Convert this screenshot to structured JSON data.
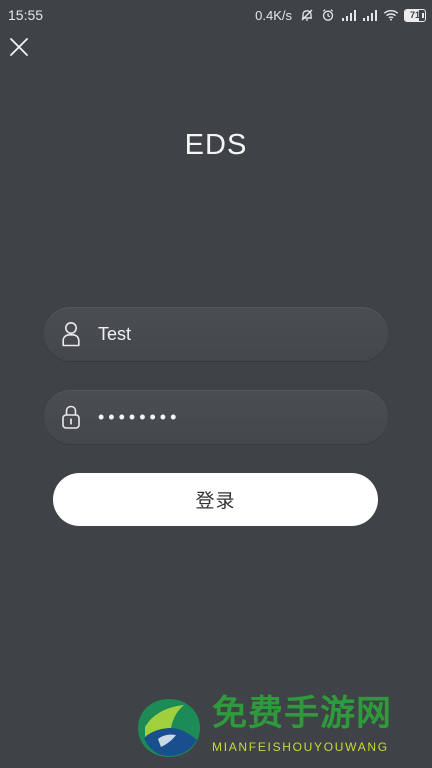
{
  "status_bar": {
    "time": "15:55",
    "network_speed": "0.4K/s",
    "battery_level": "71",
    "battery_fraction": 0.71,
    "icons": [
      "notification-muted-icon",
      "alarm-icon",
      "signal-icon",
      "signal-icon",
      "wifi-icon",
      "battery-icon"
    ]
  },
  "header": {
    "close_icon": "close-icon",
    "title": "EDS"
  },
  "login_form": {
    "username": {
      "icon": "user-icon",
      "value": "Test"
    },
    "password": {
      "icon": "lock-icon",
      "masked_value": "••••••••"
    },
    "submit_label": "登录"
  },
  "watermark": {
    "title": "免费手游网",
    "subtitle": "MIANFEISHOUYOUWANG"
  },
  "colors": {
    "background": "#3f4246",
    "field": "#484c51",
    "button": "#ffffff",
    "watermark_green": "#2f9a3b",
    "watermark_yellow": "#c9d93a"
  }
}
